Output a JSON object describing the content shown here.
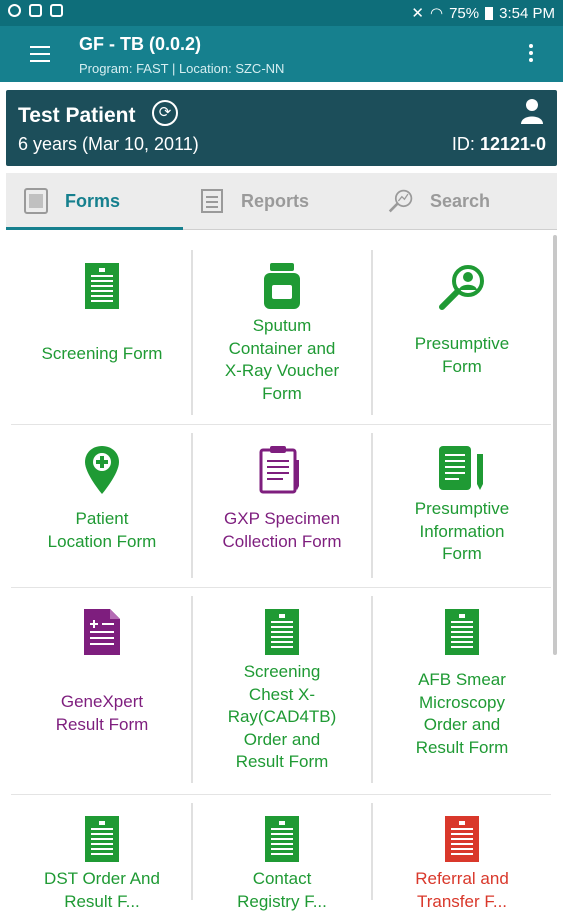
{
  "status_bar": {
    "battery": "75%",
    "time": "3:54 PM"
  },
  "app_bar": {
    "title": "GF - TB (0.0.2)",
    "subtitle": "Program: FAST  |  Location: SZC-NN"
  },
  "patient": {
    "name": "Test Patient",
    "age": "6 years (Mar 10, 2011)",
    "id_label": "ID:",
    "id_value": "12121-0"
  },
  "tabs": [
    {
      "label": "Forms",
      "icon": "forms-icon",
      "active": true
    },
    {
      "label": "Reports",
      "icon": "reports-icon",
      "active": false
    },
    {
      "label": "Search",
      "icon": "search-chart-icon",
      "active": false
    }
  ],
  "forms": [
    {
      "lines": [
        "Screening Form"
      ],
      "icon": "form-icon",
      "color": "#1f9a34"
    },
    {
      "lines": [
        "Sputum",
        "Container and",
        "X-Ray Voucher",
        "Form"
      ],
      "icon": "container-icon",
      "color": "#1f9a34"
    },
    {
      "lines": [
        "Presumptive",
        "Form"
      ],
      "icon": "magnifier-person-icon",
      "color": "#1f9a34"
    },
    {
      "lines": [
        "Patient",
        "Location Form"
      ],
      "icon": "location-pin-icon",
      "color": "#1f9a34"
    },
    {
      "lines": [
        "GXP Specimen",
        "Collection Form"
      ],
      "icon": "clipboard-icon",
      "color": "#7e1e7e"
    },
    {
      "lines": [
        "Presumptive",
        "Information",
        "Form"
      ],
      "icon": "document-pen-icon",
      "color": "#1f9a34"
    },
    {
      "lines": [
        "GeneXpert",
        "Result Form"
      ],
      "icon": "result-document-icon",
      "color": "#7e1e7e"
    },
    {
      "lines": [
        "Screening",
        "Chest X-",
        "Ray(CAD4TB)",
        "Order and",
        "Result Form"
      ],
      "icon": "form-icon",
      "color": "#1f9a34"
    },
    {
      "lines": [
        "AFB Smear",
        "Microscopy",
        "Order and",
        "Result Form"
      ],
      "icon": "form-icon",
      "color": "#1f9a34"
    },
    {
      "lines": [
        "DST Order And",
        "Result F..."
      ],
      "icon": "form-icon",
      "color": "#1f9a34"
    },
    {
      "lines": [
        "Contact",
        "Registry F..."
      ],
      "icon": "form-icon",
      "color": "#1f9a34"
    },
    {
      "lines": [
        "Referral and",
        "Transfer F..."
      ],
      "icon": "form-icon",
      "color": "#d9382b"
    }
  ]
}
